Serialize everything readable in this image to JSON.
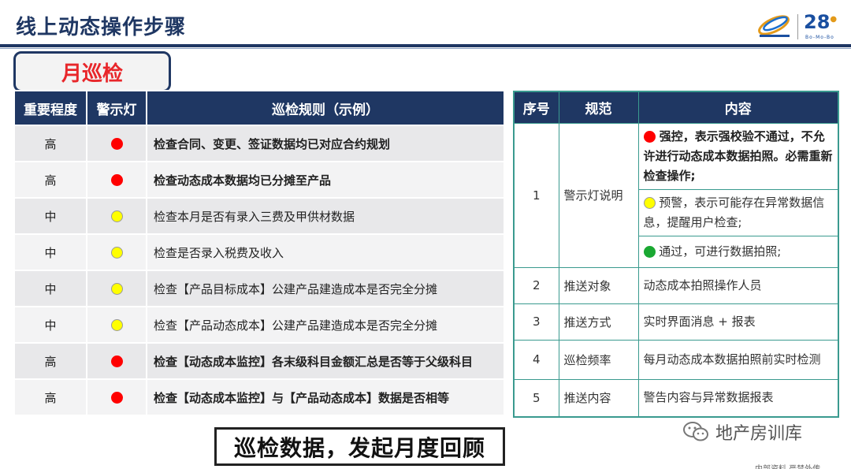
{
  "header": {
    "title": "线上动态操作步骤",
    "brand_28": "28",
    "brand_28_sub": "Bo-Mo-Bo"
  },
  "section_tab": "月巡检",
  "left_table": {
    "headers": [
      "重要程度",
      "警示灯",
      "巡检规则（示例）"
    ],
    "rows": [
      {
        "level": "高",
        "light": "red",
        "rule": "检查合同、变更、签证数据均已对应合约规划",
        "bold": true
      },
      {
        "level": "高",
        "light": "red",
        "rule": "检查动态成本数据均已分摊至产品",
        "bold": true
      },
      {
        "level": "中",
        "light": "yellow",
        "rule": "检查本月是否有录入三费及甲供材数据",
        "bold": false
      },
      {
        "level": "中",
        "light": "yellow",
        "rule": "检查是否录入税费及收入",
        "bold": false
      },
      {
        "level": "中",
        "light": "yellow",
        "rule": "检查【产品目标成本】公建产品建造成本是否完全分摊",
        "bold": false
      },
      {
        "level": "中",
        "light": "yellow",
        "rule": "检查【产品动态成本】公建产品建造成本是否完全分摊",
        "bold": false
      },
      {
        "level": "高",
        "light": "red",
        "rule": "检查【动态成本监控】各末级科目金额汇总是否等于父级科目",
        "bold": true
      },
      {
        "level": "高",
        "light": "red",
        "rule": "检查【动态成本监控】与【产品动态成本】数据是否相等",
        "bold": true
      }
    ]
  },
  "right_table": {
    "headers": [
      "序号",
      "规范",
      "内容"
    ],
    "row1": {
      "num": "1",
      "spec": "警示灯说明",
      "items": [
        "强控，表示强校验不通过，不允许进行动态成本数据拍照。必需重新检查操作;",
        "预警，表示可能存在异常数据信息，提醒用户检查;",
        "通过，可进行数据拍照;"
      ]
    },
    "rows": [
      {
        "num": "2",
        "spec": "推送对象",
        "content": "动态成本拍照操作人员"
      },
      {
        "num": "3",
        "spec": "推送方式",
        "content": "实时界面消息 + 报表"
      },
      {
        "num": "4",
        "spec": "巡检频率",
        "content": "每月动态成本数据拍照前实时检测"
      },
      {
        "num": "5",
        "spec": "推送内容",
        "content": "警告内容与异常数据报表"
      }
    ]
  },
  "bottom_banner": "巡检数据，发起月度回顾",
  "watermark": "地产房训库",
  "footer_note": "内部资料 严禁外传"
}
